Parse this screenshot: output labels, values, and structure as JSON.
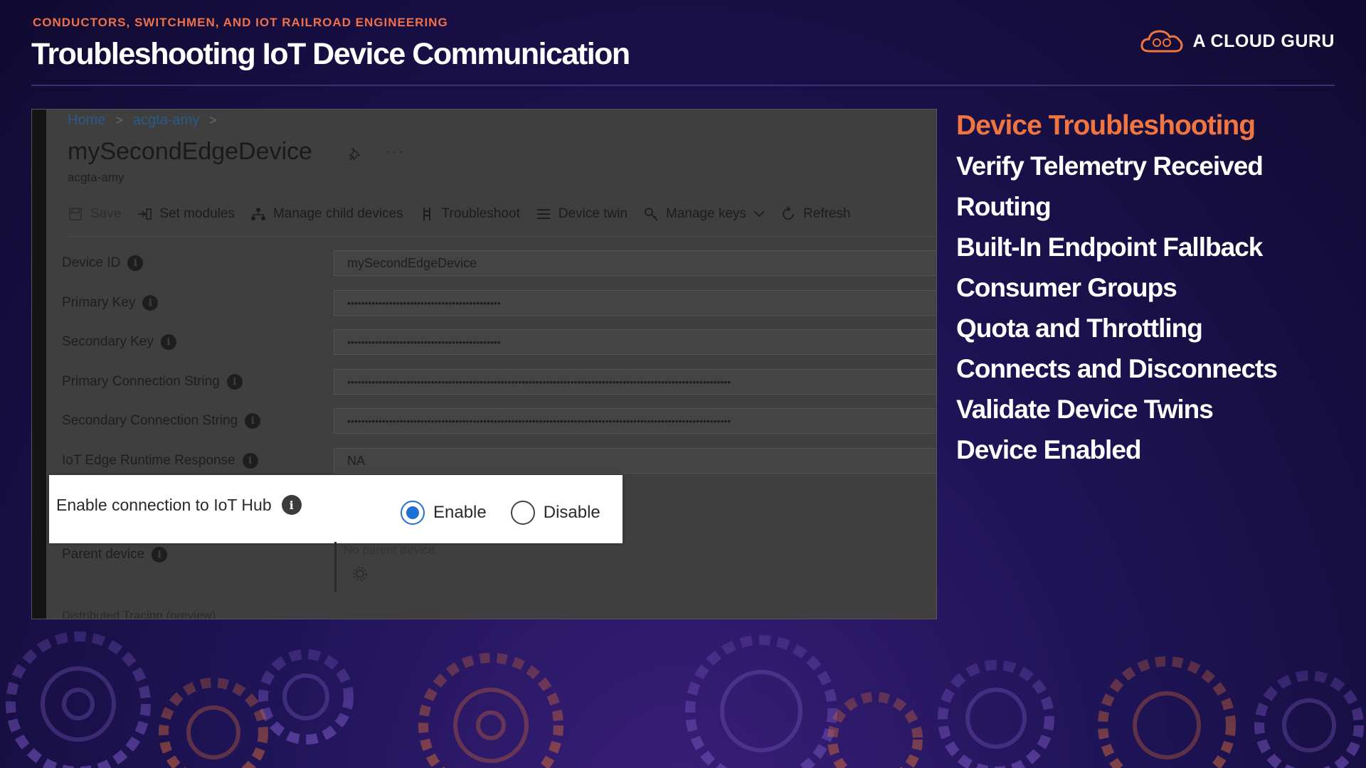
{
  "header": {
    "kicker": "CONDUCTORS, SWITCHMEN, AND IOT RAILROAD ENGINEERING",
    "title": "Troubleshooting IoT Device Communication",
    "brand": "A CLOUD GURU"
  },
  "portal": {
    "breadcrumbs": [
      "Home",
      "acgta-amy"
    ],
    "device_name": "mySecondEdgeDevice",
    "subtitle": "acgta-amy",
    "toolbar": [
      {
        "label": "Save",
        "icon": "save-icon",
        "disabled": true
      },
      {
        "label": "Set modules",
        "icon": "set-modules-icon"
      },
      {
        "label": "Manage child devices",
        "icon": "child-devices-icon"
      },
      {
        "label": "Troubleshoot",
        "icon": "troubleshoot-icon"
      },
      {
        "label": "Device twin",
        "icon": "list-icon"
      },
      {
        "label": "Manage keys",
        "icon": "key-icon"
      },
      {
        "label": "Refresh",
        "icon": "refresh-icon"
      }
    ],
    "fields": [
      {
        "label": "Device ID",
        "value": "mySecondEdgeDevice"
      },
      {
        "label": "Primary Key",
        "value": "••••••••••••••••••••••••••••••••••••••••••••"
      },
      {
        "label": "Secondary Key",
        "value": "••••••••••••••••••••••••••••••••••••••••••••"
      },
      {
        "label": "Primary Connection String",
        "value": "••••••••••••••••••••••••••••••••••••••••••••••••••••••••••••••••••••••••••••••••••••••••••••••••••••••••••••••"
      },
      {
        "label": "Secondary Connection String",
        "value": "••••••••••••••••••••••••••••••••••••••••••••••••••••••••••••••••••••••••••••••••••••••••••••••••••••••••••••••"
      },
      {
        "label": "IoT Edge Runtime Response",
        "value": "NA"
      }
    ],
    "connection": {
      "label": "Enable connection to IoT Hub",
      "options": [
        "Enable",
        "Disable"
      ],
      "selected": "Enable"
    },
    "parent_device": {
      "label": "Parent device",
      "value": "No parent device"
    },
    "cut_off_label": "Distributed Tracing (preview)"
  },
  "topics": [
    "Device Troubleshooting",
    "Verify Telemetry Received",
    "Routing",
    "Built-In Endpoint Fallback",
    "Consumer Groups",
    "Quota and Throttling",
    "Connects and Disconnects",
    "Validate Device Twins",
    "Device Enabled"
  ],
  "colors": {
    "accent": "#f0753f",
    "radio_selected": "#1f6fd6"
  }
}
